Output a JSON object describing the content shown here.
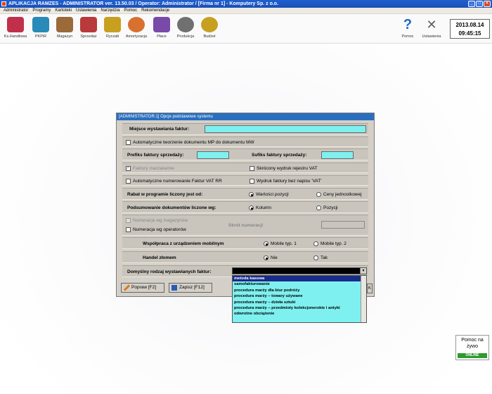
{
  "window": {
    "title": "APLIKACJA RAMZES - ADMINISTRATOR ver. 13.50.03 /   Operator: Administrator /   [Firma nr 1] - Komputery Sp. z o.o."
  },
  "menu": [
    "Administrator",
    "Programy",
    "Kartoteki",
    "Ustawienia",
    "Narzędzia",
    "Pomoc",
    "Rekomendacje"
  ],
  "toolbar": {
    "items": [
      "Ks.Handlowa",
      "PKPiR",
      "Magazyn",
      "Sprzedaż",
      "Ryczałt",
      "Amortyzacja",
      "Płace",
      "Produkcja",
      "Budżet"
    ],
    "right_items": [
      "Pomoc",
      "Ustawienia"
    ],
    "colors": [
      "#c0304a",
      "#2a8ab8",
      "#9a6a3a",
      "#b83a3a",
      "#c8a020",
      "#d87030",
      "#7a4aa8",
      "#707070",
      "#c8a020",
      "#1a6ac8",
      "#606060"
    ]
  },
  "clock": {
    "date": "2013.08.14",
    "time": "09:45:15"
  },
  "dialog": {
    "title": "[ADMINISTRATOR:1]  Opcje podstawowe systemu",
    "miejsce_label": "Miejsce wystawiania faktur:",
    "auto_mp_label": "Automatyczne tworzenie dokumentu MP do dokumentu MW",
    "prefiks_label": "Prefiks faktury sprzedaży:",
    "sufiks_label": "Sufiks faktury sprzedaży:",
    "faktury_marzowe_label": "Faktury marżakamie",
    "skrocony_label": "Skrócony wydruk rejestru VAT",
    "auto_num_label": "Automatyczne numerowanie Faktur VAT RR",
    "wydruk_bez_label": "Wydruk faktury bez napisu 'VAT'",
    "rabat_label": "Rabat w programie liczony jest od:",
    "rabat_opt1": "Wartości pozycji",
    "rabat_opt2": "Ceny jednostkowej",
    "podsum_label": "Podsumowanie dokumentów liczone wg:",
    "podsum_opt1": "Kolumn",
    "podsum_opt2": "Pozycji",
    "num_mag_label": "Numeracja wg magazynów",
    "num_oper_label": "Numeracja wg operatorów",
    "skrot_label": "Skrót numeracji",
    "wspolpraca_label": "Współpraca z urządzeniem mobilnym",
    "mobile1": "Mobile typ. 1",
    "mobile2": "Mobile typ. 2",
    "handel_label": "Handel złomem",
    "nie": "Nie",
    "tak": "Tak",
    "domyslny_label": "Domyślny rodzaj wystawianych faktur:",
    "btn_popraw": "Popraw   [F2]",
    "btn_zapisz": "Zapisz   [F12]"
  },
  "dropdown": {
    "options": [
      "metoda kasowa",
      "samofakturowanie",
      "procedura marży dla biur podróży",
      "procedura marży – towary używane",
      "procedura marży – dzieła sztuki",
      "procedura marży – przedmioty kolekcjonerskie i antyki",
      "odwrotne obciążenie"
    ]
  },
  "help": {
    "line1": "Pomoc na",
    "line2": "żywo",
    "status": "ONLINE"
  }
}
